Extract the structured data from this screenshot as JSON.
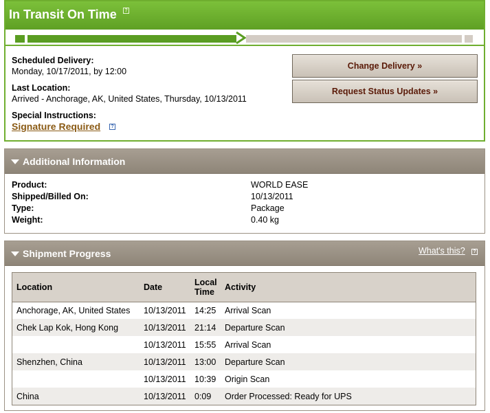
{
  "status": {
    "title": "In Transit On Time",
    "help_icon": "help-icon",
    "progress_fraction": 0.48,
    "scheduled_delivery_label": "Scheduled Delivery:",
    "scheduled_delivery_value": "Monday, 10/17/2011, by 12:00",
    "last_location_label": "Last Location:",
    "last_location_value": "Arrived - Anchorage, AK, United States, Thursday, 10/13/2011",
    "special_instructions_label": "Special Instructions:",
    "special_instructions_link": "Signature Required",
    "change_delivery_button": "Change Delivery »",
    "request_updates_button": "Request Status Updates »"
  },
  "additional_info": {
    "title": "Additional Information",
    "rows": [
      {
        "label": "Product:",
        "value": "WORLD EASE"
      },
      {
        "label": "Shipped/Billed On:",
        "value": "10/13/2011"
      },
      {
        "label": "Type:",
        "value": "Package"
      },
      {
        "label": "Weight:",
        "value": "0.40 kg"
      }
    ]
  },
  "shipment_progress": {
    "title": "Shipment Progress",
    "whats_this": "What's this?",
    "columns": {
      "location": "Location",
      "date": "Date",
      "time_line1": "Local",
      "time_line2": "Time",
      "activity": "Activity"
    },
    "rows": [
      {
        "location": "Anchorage, AK, United States",
        "date": "10/13/2011",
        "time": "14:25",
        "activity": "Arrival Scan"
      },
      {
        "location": "Chek Lap Kok, Hong Kong",
        "date": "10/13/2011",
        "time": "21:14",
        "activity": "Departure Scan"
      },
      {
        "location": "",
        "date": "10/13/2011",
        "time": "15:55",
        "activity": "Arrival Scan"
      },
      {
        "location": "Shenzhen, China",
        "date": "10/13/2011",
        "time": "13:00",
        "activity": "Departure Scan"
      },
      {
        "location": "",
        "date": "10/13/2011",
        "time": "10:39",
        "activity": "Origin Scan"
      },
      {
        "location": "China",
        "date": "10/13/2011",
        "time": "0:09",
        "activity": "Order Processed: Ready for UPS"
      }
    ]
  },
  "colors": {
    "status_green": "#6fae2f",
    "panel_taupe": "#9b9183",
    "button_text": "#5a1a08",
    "link_brown": "#8a5a14"
  }
}
